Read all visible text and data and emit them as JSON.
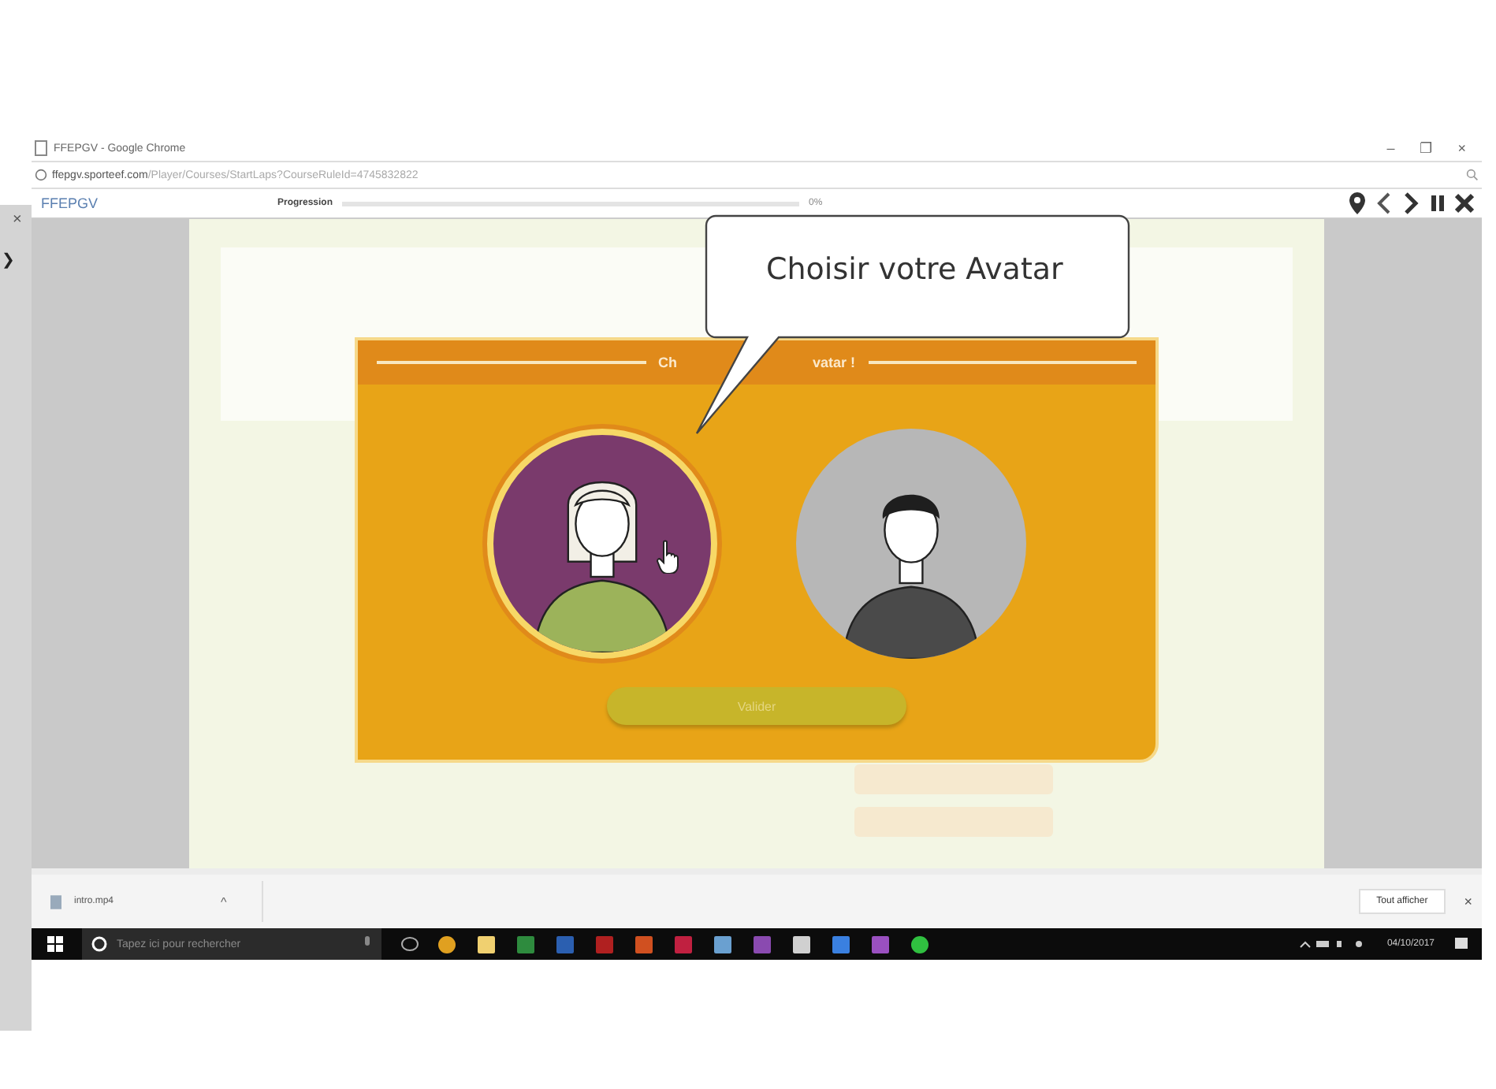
{
  "side_panel": {
    "close": "×",
    "arrow": "❯"
  },
  "window": {
    "title": "FFEPGV - Google Chrome",
    "controls": [
      "–",
      "❐",
      "×"
    ]
  },
  "address_bar": {
    "domain": "ffepgv.sporteef.com",
    "path": "/Player/Courses/StartLaps?CourseRuleId=4745832822"
  },
  "course_bar": {
    "brand": "FFEPGV",
    "progress_label": "Progression",
    "level": 0,
    "reading": "0%"
  },
  "callout": {
    "text": "Choisir votre Avatar"
  },
  "modal": {
    "title_parts": [
      "Ch",
      "vatar !"
    ],
    "avatars": [
      {
        "kind": "female",
        "selected": true
      },
      {
        "kind": "male",
        "selected": false
      }
    ],
    "button": "Valider"
  },
  "downloads": {
    "file": "intro.mp4",
    "caret": "^",
    "show_all": "Tout afficher",
    "close": "×"
  },
  "taskbar": {
    "search_placeholder": "Tapez ici pour rechercher",
    "date": "04/10/2017"
  }
}
